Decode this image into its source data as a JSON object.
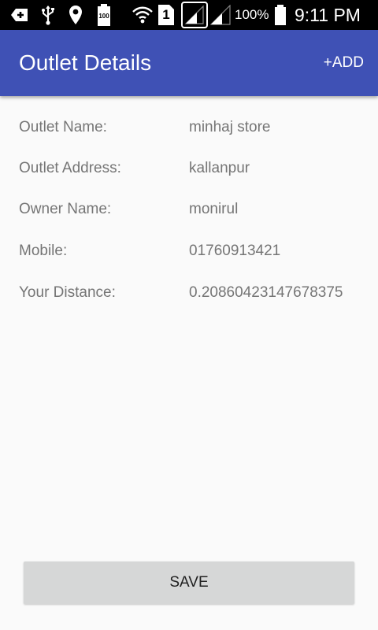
{
  "status_bar": {
    "battery_level": "100",
    "sim_slot": "1",
    "battery_percent": "100%",
    "time": "9:11 PM",
    "icons": [
      "notification-plus-icon",
      "usb-icon",
      "location-pin-icon",
      "battery-saver-icon",
      "wifi-icon",
      "sim-icon",
      "signal-icon",
      "signal-icon",
      "battery-icon"
    ]
  },
  "app_bar": {
    "title": "Outlet Details",
    "add_label": "+ADD",
    "color": "#3f51b5"
  },
  "details": [
    {
      "label": "Outlet Name:",
      "value": "minhaj store"
    },
    {
      "label": "Outlet Address:",
      "value": "kallanpur"
    },
    {
      "label": "Owner Name:",
      "value": "monirul"
    },
    {
      "label": "Mobile:",
      "value": "01760913421"
    },
    {
      "label": "Your Distance:",
      "value": "0.20860423147678375"
    }
  ],
  "save_label": "SAVE"
}
